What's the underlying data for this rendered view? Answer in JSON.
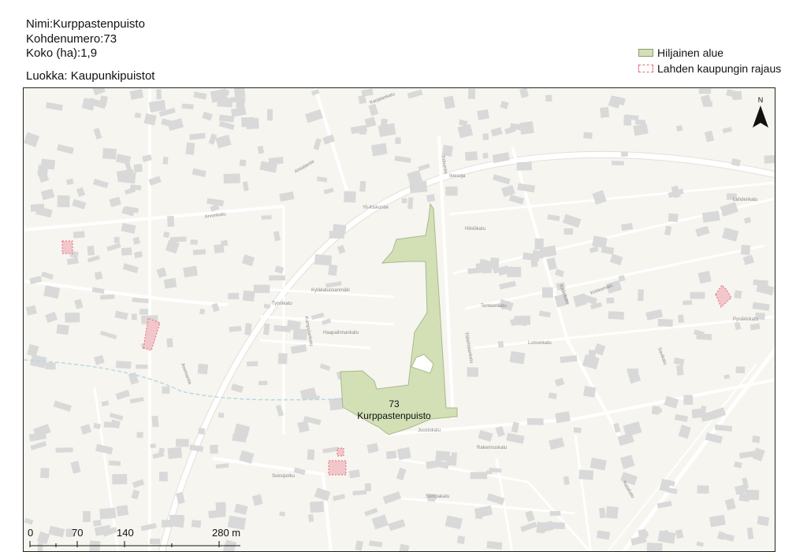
{
  "info": {
    "name": "Nimi:Kurppastenpuisto",
    "number": "Kohdenumero:73",
    "size": "Koko (ha):1,9",
    "class": "Luokka: Kaupunkipuistot"
  },
  "legend": {
    "items": [
      {
        "label": "Hiljainen alue",
        "color": "#d3e0b6"
      },
      {
        "label": "Lahden kaupungin rajaus",
        "color": "#e36b7e"
      }
    ]
  },
  "map": {
    "area_number": "73",
    "area_name": "Kurppastenpuisto",
    "north": "N",
    "street_labels": [
      "Karjalankatu",
      "Ahtialantie",
      "Tirihuntie",
      "Ilvesoja",
      "Yli-Kiskontie",
      "Arvonkatu",
      "Hiisiökatu",
      "Kyläkatuosanmäki",
      "Tynnikatu",
      "Kumpulankatu",
      "Haapalinnankatu",
      "Tiilitehtaankatu",
      "Kalliokatu",
      "Lahdenkatu",
      "Kirkkomäki",
      "Tenteenkatu",
      "Lumonkatu",
      "Pysäkkikatu",
      "Savikatu",
      "Rakennuskatu",
      "Ratakatu",
      "Suksipolku",
      "Sompakatu",
      "Juustokatu",
      "Asemantie"
    ]
  },
  "scale": {
    "ticks": [
      "0",
      "70",
      "140",
      "280 m"
    ]
  },
  "colors": {
    "background": "#f6f5ef",
    "road": "#ffffff",
    "building": "#d9d9d9",
    "park": "#d3e0b6",
    "city_boundary": "#e36b7e",
    "stream": "#b9d9e3"
  }
}
